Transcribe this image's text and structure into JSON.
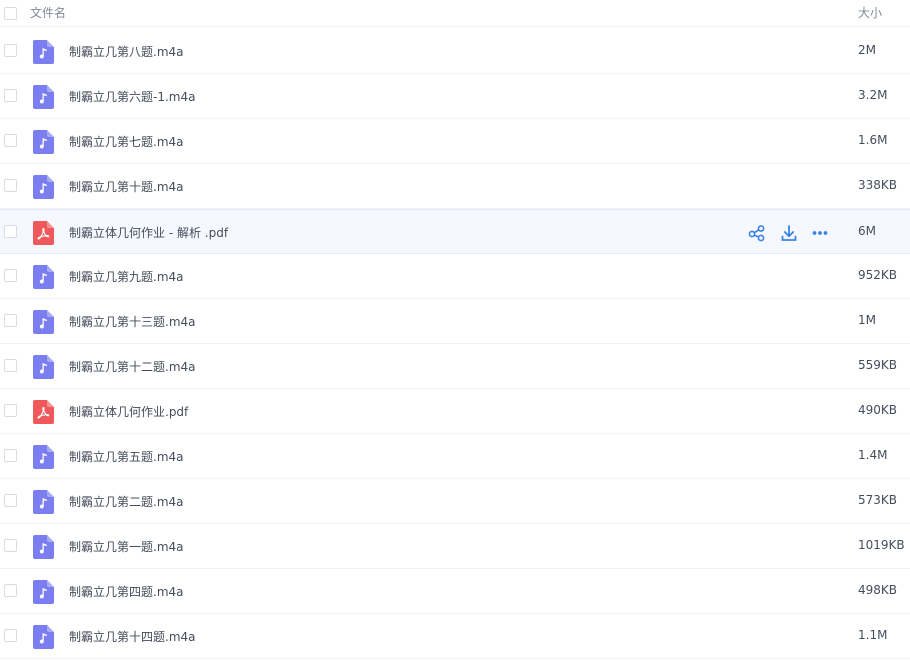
{
  "header": {
    "name_label": "文件名",
    "size_label": "大小"
  },
  "colors": {
    "audio_icon": "#7b7ef0",
    "pdf_icon": "#f0595b",
    "action_icon": "#3b82e6",
    "hover_row": "#f5f9ff"
  },
  "row_actions": {
    "share_icon": "share-icon",
    "download_icon": "download-icon",
    "more_icon": "more-icon"
  },
  "files": [
    {
      "name": "制霸立几第八题.m4a",
      "size": "2M",
      "type": "audio"
    },
    {
      "name": "制霸立几第六题-1.m4a",
      "size": "3.2M",
      "type": "audio"
    },
    {
      "name": "制霸立几第七题.m4a",
      "size": "1.6M",
      "type": "audio"
    },
    {
      "name": "制霸立几第十题.m4a",
      "size": "338KB",
      "type": "audio"
    },
    {
      "name": "制霸立体几何作业 - 解析 .pdf",
      "size": "6M",
      "type": "pdf",
      "hovered": true
    },
    {
      "name": "制霸立几第九题.m4a",
      "size": "952KB",
      "type": "audio"
    },
    {
      "name": "制霸立几第十三题.m4a",
      "size": "1M",
      "type": "audio"
    },
    {
      "name": "制霸立几第十二题.m4a",
      "size": "559KB",
      "type": "audio"
    },
    {
      "name": "制霸立体几何作业.pdf",
      "size": "490KB",
      "type": "pdf"
    },
    {
      "name": "制霸立几第五题.m4a",
      "size": "1.4M",
      "type": "audio"
    },
    {
      "name": "制霸立几第二题.m4a",
      "size": "573KB",
      "type": "audio"
    },
    {
      "name": "制霸立几第一题.m4a",
      "size": "1019KB",
      "type": "audio"
    },
    {
      "name": "制霸立几第四题.m4a",
      "size": "498KB",
      "type": "audio"
    },
    {
      "name": "制霸立几第十四题.m4a",
      "size": "1.1M",
      "type": "audio"
    }
  ]
}
